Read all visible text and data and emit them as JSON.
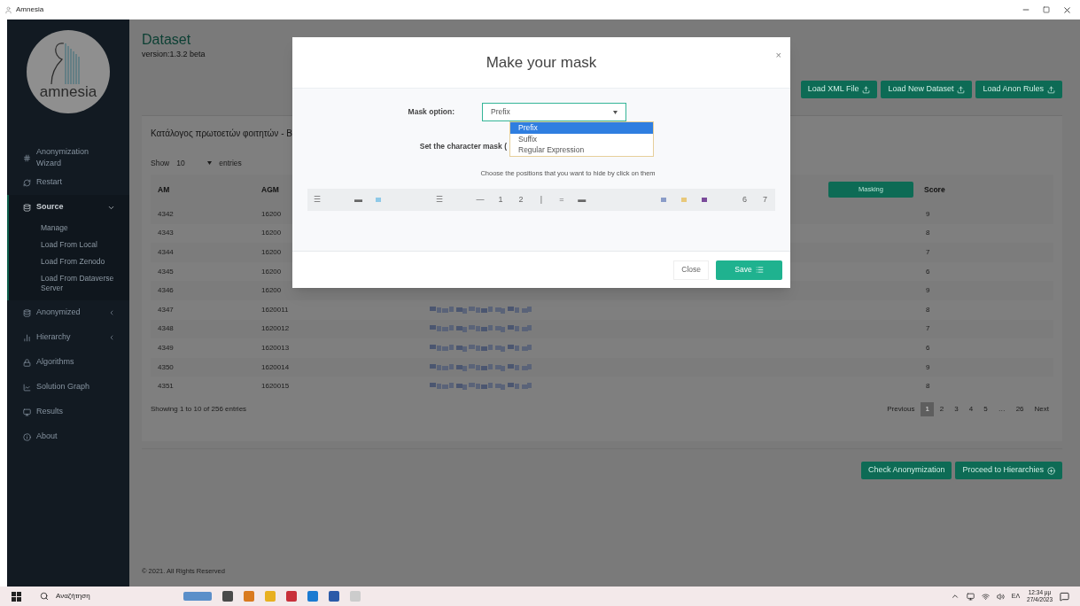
{
  "window": {
    "title": "Amnesia"
  },
  "sidebar": {
    "logo_text": "amnesia",
    "items": [
      {
        "label": "Anonymization Wizard",
        "selected": false
      },
      {
        "label": "Restart",
        "selected": false
      },
      {
        "label": "Source",
        "selected": true,
        "expanded": true,
        "children": [
          {
            "label": "Manage"
          },
          {
            "label": "Load From Local"
          },
          {
            "label": "Load From Zenodo"
          },
          {
            "label": "Load From Dataverse Server"
          }
        ]
      },
      {
        "label": "Anonymized",
        "selected": false,
        "expanded": false
      },
      {
        "label": "Hierarchy",
        "selected": false,
        "expanded": false
      },
      {
        "label": "Algorithms",
        "selected": false
      },
      {
        "label": "Solution Graph",
        "selected": false
      },
      {
        "label": "Results",
        "selected": false
      },
      {
        "label": "About",
        "selected": false
      }
    ]
  },
  "page": {
    "title": "Dataset",
    "version": "version:1.3.2 beta"
  },
  "toolbar": [
    {
      "label": "Load XML File"
    },
    {
      "label": "Load New Dataset"
    },
    {
      "label": "Load Anon Rules"
    }
  ],
  "table": {
    "caption": "Κατάλογος πρωτοετών φοιτητών - Β",
    "show_label": "Show",
    "length_value": "10",
    "entries_label": "entries",
    "columns": [
      "AM",
      "AGM",
      "Masking",
      "Score"
    ],
    "rows": [
      {
        "am": "4342",
        "agm": "16200",
        "score": "9"
      },
      {
        "am": "4343",
        "agm": "16200",
        "score": "8"
      },
      {
        "am": "4344",
        "agm": "16200",
        "score": "7"
      },
      {
        "am": "4345",
        "agm": "16200",
        "score": "6"
      },
      {
        "am": "4346",
        "agm": "16200",
        "score": "9"
      },
      {
        "am": "4347",
        "agm": "1620011",
        "score": "8",
        "blurred": true
      },
      {
        "am": "4348",
        "agm": "1620012",
        "score": "7",
        "blurred": true
      },
      {
        "am": "4349",
        "agm": "1620013",
        "score": "6",
        "blurred": true
      },
      {
        "am": "4350",
        "agm": "1620014",
        "score": "9",
        "blurred": true
      },
      {
        "am": "4351",
        "agm": "1620015",
        "score": "8",
        "blurred": true
      }
    ],
    "info": "Showing 1 to 10 of 256 entries",
    "pagination": [
      {
        "label": "Previous",
        "selected": false
      },
      {
        "label": "1",
        "selected": true
      },
      {
        "label": "2",
        "selected": false
      },
      {
        "label": "3",
        "selected": false
      },
      {
        "label": "4",
        "selected": false
      },
      {
        "label": "5",
        "selected": false
      },
      {
        "label": "…",
        "selected": false
      },
      {
        "label": "26",
        "selected": false
      },
      {
        "label": "Next",
        "selected": false
      }
    ]
  },
  "actions": [
    {
      "label": "Check Anonymization"
    },
    {
      "label": "Proceed to Hierarchies"
    }
  ],
  "footer": "© 2021. All Rights Reserved",
  "modal": {
    "title": "Make your mask",
    "close": "×",
    "mask_label": "Mask option:",
    "mask_value": "Prefix",
    "options": [
      {
        "label": "Prefix",
        "selected": true
      },
      {
        "label": "Suffix",
        "selected": false
      },
      {
        "label": "Regular Expression",
        "selected": false
      }
    ],
    "char_mask_label": "Set the character mask (",
    "hint": "Choose the positions that you want to hide by click on them",
    "positions": [
      {
        "kind": "char",
        "text": "☰"
      },
      {
        "kind": "space"
      },
      {
        "kind": "char",
        "text": "▬"
      },
      {
        "kind": "swatch",
        "color": "#8fc9e8"
      },
      {
        "kind": "space"
      },
      {
        "kind": "space"
      },
      {
        "kind": "char",
        "text": "☰"
      },
      {
        "kind": "space"
      },
      {
        "kind": "char",
        "text": "—"
      },
      {
        "kind": "char",
        "text": "1"
      },
      {
        "kind": "char",
        "text": "2"
      },
      {
        "kind": "char",
        "text": "|"
      },
      {
        "kind": "char",
        "text": "="
      },
      {
        "kind": "char",
        "text": "▬"
      },
      {
        "kind": "space"
      },
      {
        "kind": "space"
      },
      {
        "kind": "space"
      },
      {
        "kind": "swatch",
        "color": "#8a9cc8"
      },
      {
        "kind": "swatch",
        "color": "#e8c87a"
      },
      {
        "kind": "swatch",
        "color": "#7a4a9a"
      },
      {
        "kind": "space"
      },
      {
        "kind": "char",
        "text": "6"
      },
      {
        "kind": "char",
        "text": "7"
      }
    ],
    "buttons": [
      {
        "label": "Close",
        "kind": "plain"
      },
      {
        "label": "Save",
        "kind": "primary"
      }
    ]
  },
  "taskbar": {
    "search_placeholder": "Αναζήτηση",
    "language": "ΕΛ",
    "time": "12:34 μμ",
    "date": "27/4/2023"
  }
}
